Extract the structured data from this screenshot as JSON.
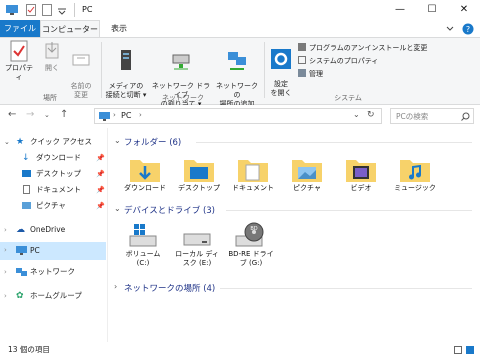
{
  "window": {
    "title": "PC",
    "minimize": "—",
    "maximize": "☐",
    "close": "✕"
  },
  "ribbon_tabs": [
    "ファイル",
    "コンピューター",
    "表示"
  ],
  "ribbon": {
    "location_group": {
      "label": "場所",
      "buttons": [
        "プロパティ",
        "開く",
        "名前の\n変更"
      ]
    },
    "network_group": {
      "label": "ネットワーク",
      "buttons": [
        "メディアの\n接続と切断 ▾",
        "ネットワーク ドライブ\nの割り当て ▾",
        "ネットワークの\n場所の追加"
      ]
    },
    "system_group": {
      "label": "システム",
      "settings_button": "設定\nを開く",
      "items": [
        "プログラムのアンインストールと変更",
        "システムのプロパティ",
        "管理"
      ]
    }
  },
  "address": {
    "path": "PC",
    "search_placeholder": "PCの検索"
  },
  "nav_pane": {
    "quick_access": "クイック アクセス",
    "quick_items": [
      "ダウンロード",
      "デスクトップ",
      "ドキュメント",
      "ピクチャ"
    ],
    "onedrive": "OneDrive",
    "pc": "PC",
    "network": "ネットワーク",
    "homegroup": "ホームグループ"
  },
  "content": {
    "folders_header": "フォルダー (6)",
    "folders": [
      "ダウンロード",
      "デスクトップ",
      "ドキュメント",
      "ピクチャ",
      "ビデオ",
      "ミュージック"
    ],
    "drives_header": "デバイスとドライブ (3)",
    "drives": [
      {
        "line1": "ボリューム",
        "line2": "(C:)"
      },
      {
        "line1": "ローカル ディ",
        "line2": "スク (E:)"
      },
      {
        "line1": "BD-RE ドライ",
        "line2": "ブ (G:)"
      }
    ],
    "network_header": "ネットワークの場所 (4)"
  },
  "status": {
    "count": "13 個の項目"
  },
  "colors": {
    "accent": "#1979ca",
    "folder": "#f7d26a",
    "header_text": "#1e3287",
    "selected": "#cce8ff"
  }
}
